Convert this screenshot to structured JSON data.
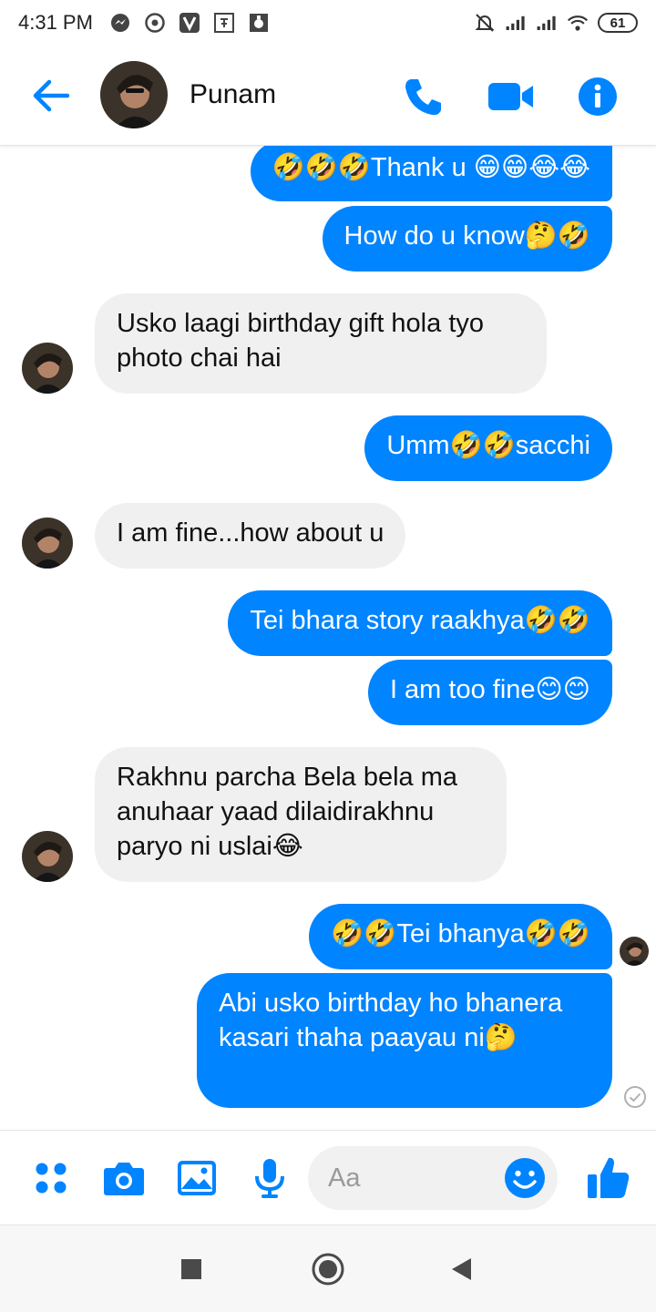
{
  "status_bar": {
    "time": "4:31 PM",
    "battery": "61",
    "left_icons": [
      "messenger-icon",
      "chrome-icon",
      "viber-icon",
      "app-icon",
      "badge-icon"
    ],
    "right_icons": [
      "mute-icon",
      "signal-icon",
      "signal-icon",
      "wifi-icon"
    ]
  },
  "header": {
    "contact_name": "Punam",
    "back_icon": "arrow-left-icon",
    "actions": [
      "phone-icon",
      "video-icon",
      "info-icon"
    ],
    "accent_color": "#0084ff"
  },
  "messages": [
    {
      "from": "me",
      "text": "🤣🤣🤣Thank u 😁😁😂😂"
    },
    {
      "from": "me",
      "text": "How do u know🤔🤣"
    },
    {
      "from": "them",
      "text": "Usko laagi birthday gift hola tyo photo chai hai"
    },
    {
      "from": "me",
      "text": "Umm🤣🤣sacchi"
    },
    {
      "from": "them",
      "text": "I am fine...how about u"
    },
    {
      "from": "me",
      "text": "Tei bhara story raakhya🤣🤣"
    },
    {
      "from": "me",
      "text": "I am too fine😊😊"
    },
    {
      "from": "them",
      "text": "Rakhnu parcha Bela bela ma anuhaar yaad dilaidirakhnu paryo ni uslai😂"
    },
    {
      "from": "me",
      "text": "🤣🤣Tei bhanya🤣🤣"
    },
    {
      "from": "me",
      "text": "Abi usko birthday ho bhanera kasari thaha paayau ni🤔"
    }
  ],
  "composer": {
    "placeholder": "Aa",
    "tools": [
      "apps-icon",
      "camera-icon",
      "image-icon",
      "mic-icon"
    ],
    "emoji_icon": "smiley-icon",
    "like_icon": "thumbs-up-icon"
  },
  "nav": [
    "recents-square-icon",
    "home-circle-icon",
    "back-triangle-icon"
  ]
}
